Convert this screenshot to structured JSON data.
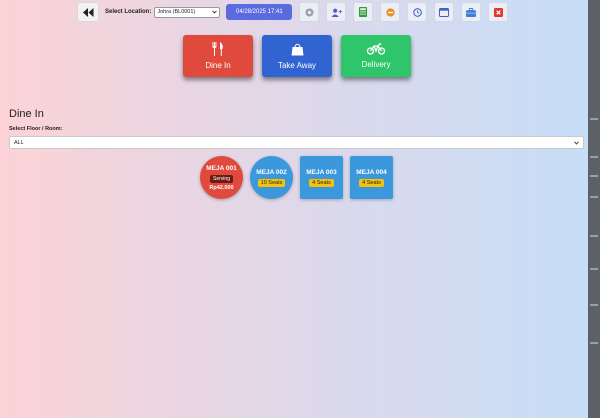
{
  "toolbar": {
    "location_label": "Select Location:",
    "location_value": "Johra (BL0001)",
    "datetime": "04/28/2025 17:41",
    "tools": [
      {
        "icon": "circle-icon",
        "color": "#8a8f99"
      },
      {
        "icon": "user-add-icon",
        "color": "#5b56c9"
      },
      {
        "icon": "calculator-icon",
        "color": "#2f9a3e"
      },
      {
        "icon": "minus-circle-icon",
        "color": "#e6901e"
      },
      {
        "icon": "clock-icon",
        "color": "#3d63c8"
      },
      {
        "icon": "window-icon",
        "color": "#3d63c8"
      },
      {
        "icon": "briefcase-icon",
        "color": "#3d7fd6"
      },
      {
        "icon": "close-icon",
        "color": "#e0392b"
      }
    ]
  },
  "order_types": {
    "dine_in": "Dine In",
    "take_away": "Take Away",
    "delivery": "Delivery"
  },
  "section": {
    "title": "Dine In",
    "floor_label": "Select Floor / Room:",
    "floor_value": "ALL"
  },
  "tables": [
    {
      "name": "MEJA 001",
      "status": "Serving",
      "amount": "Rp42.000"
    },
    {
      "name": "MEJA 002",
      "seats": "10 Seats"
    },
    {
      "name": "MEJA 003",
      "seats": "4 Seats"
    },
    {
      "name": "MEJA 004",
      "seats": "4 Seats"
    }
  ],
  "colors": {
    "dine_in": "#e04a3c",
    "take_away": "#3164d0",
    "delivery": "#2fc56a",
    "table_busy": "#e04a3c",
    "table_free": "#3b98dc",
    "seats_badge": "#f2c20c"
  }
}
